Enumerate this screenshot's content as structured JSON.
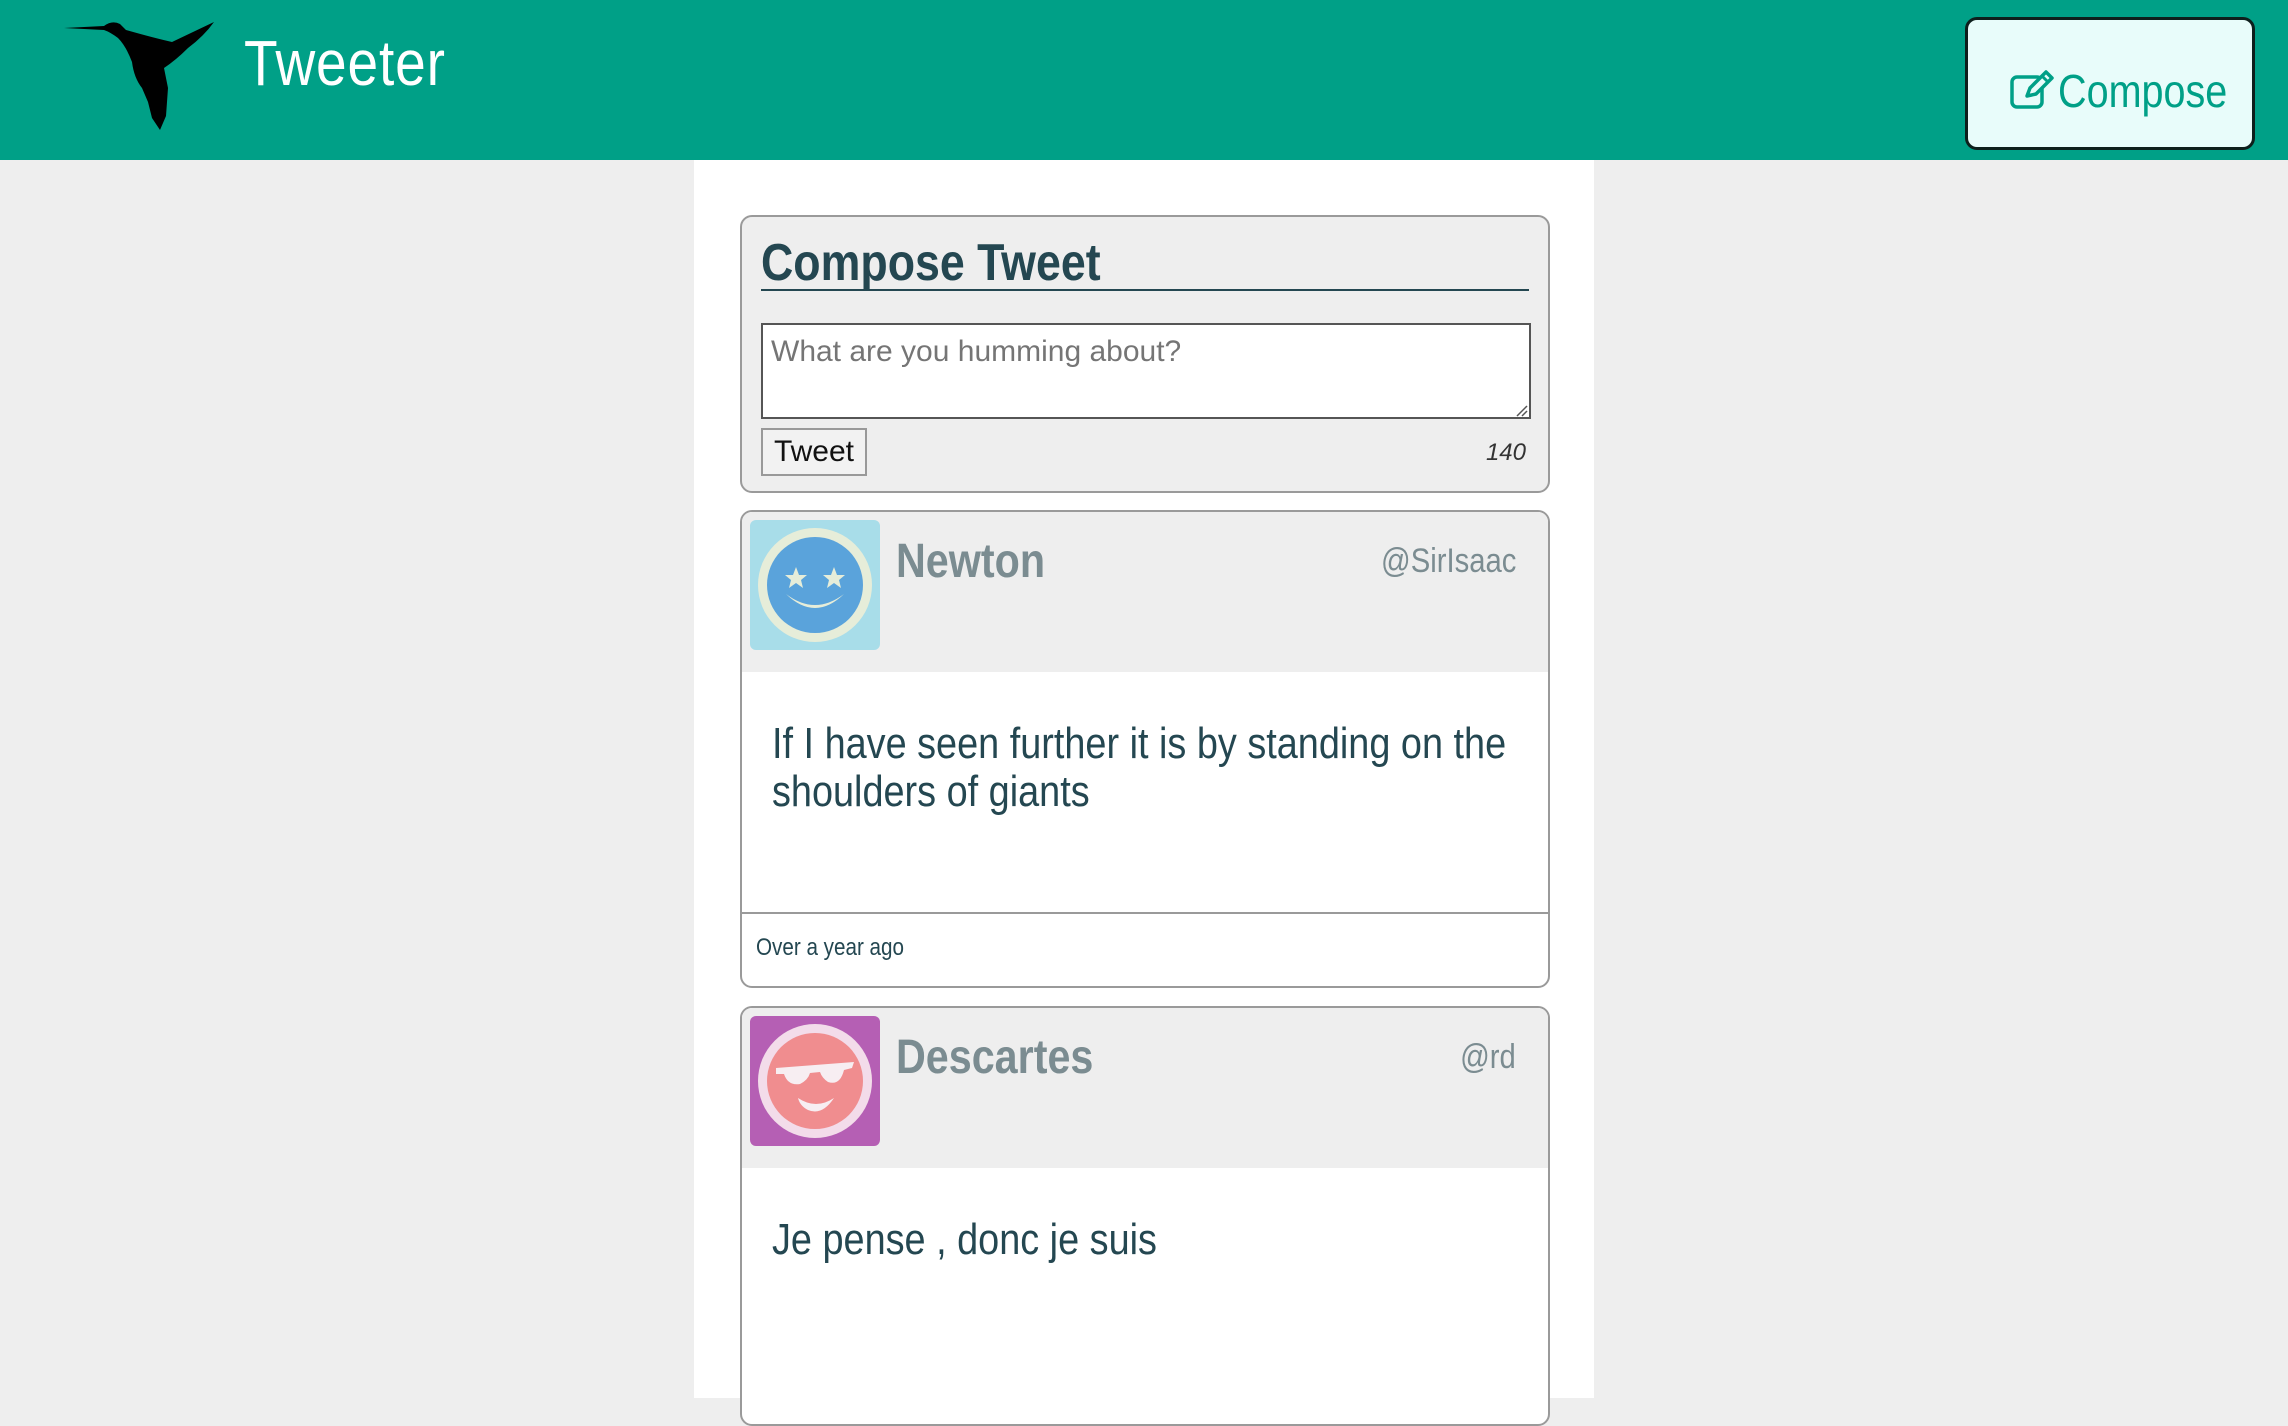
{
  "nav": {
    "brand": "Tweeter",
    "compose_label": "Compose",
    "brand_color": "#00a087"
  },
  "compose": {
    "title": "Compose Tweet",
    "placeholder": "What are you humming about?",
    "value": "",
    "submit_label": "Tweet",
    "char_count": "140"
  },
  "tweets": [
    {
      "name": "Newton",
      "handle": "@SirIsaac",
      "text": "If I have seen further it is by standing on the shoulders of giants",
      "time": "Over a year ago",
      "avatar_icon": "star-eyes-smiley-icon",
      "avatar_bg": "#a8dde9"
    },
    {
      "name": "Descartes",
      "handle": "@rd",
      "text": "Je pense , donc je suis",
      "time": "",
      "avatar_icon": "sunglasses-smiley-icon",
      "avatar_bg": "#b55fb4"
    }
  ]
}
